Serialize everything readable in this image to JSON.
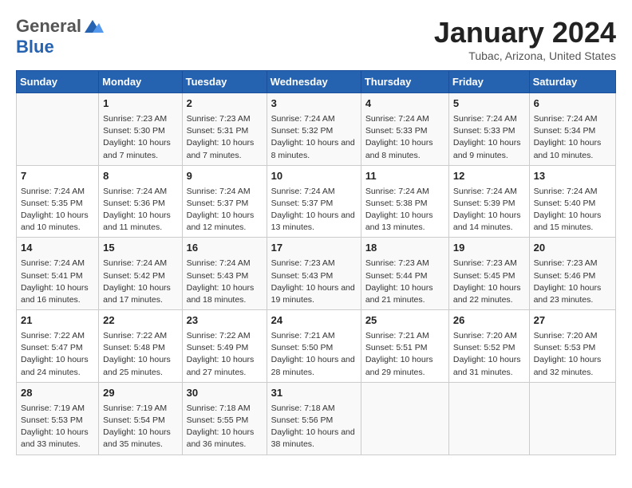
{
  "logo": {
    "general": "General",
    "blue": "Blue"
  },
  "calendar": {
    "title": "January 2024",
    "subtitle": "Tubac, Arizona, United States"
  },
  "headers": [
    "Sunday",
    "Monday",
    "Tuesday",
    "Wednesday",
    "Thursday",
    "Friday",
    "Saturday"
  ],
  "weeks": [
    [
      {
        "day": "",
        "sunrise": "",
        "sunset": "",
        "daylight": ""
      },
      {
        "day": "1",
        "sunrise": "Sunrise: 7:23 AM",
        "sunset": "Sunset: 5:30 PM",
        "daylight": "Daylight: 10 hours and 7 minutes."
      },
      {
        "day": "2",
        "sunrise": "Sunrise: 7:23 AM",
        "sunset": "Sunset: 5:31 PM",
        "daylight": "Daylight: 10 hours and 7 minutes."
      },
      {
        "day": "3",
        "sunrise": "Sunrise: 7:24 AM",
        "sunset": "Sunset: 5:32 PM",
        "daylight": "Daylight: 10 hours and 8 minutes."
      },
      {
        "day": "4",
        "sunrise": "Sunrise: 7:24 AM",
        "sunset": "Sunset: 5:33 PM",
        "daylight": "Daylight: 10 hours and 8 minutes."
      },
      {
        "day": "5",
        "sunrise": "Sunrise: 7:24 AM",
        "sunset": "Sunset: 5:33 PM",
        "daylight": "Daylight: 10 hours and 9 minutes."
      },
      {
        "day": "6",
        "sunrise": "Sunrise: 7:24 AM",
        "sunset": "Sunset: 5:34 PM",
        "daylight": "Daylight: 10 hours and 10 minutes."
      }
    ],
    [
      {
        "day": "7",
        "sunrise": "Sunrise: 7:24 AM",
        "sunset": "Sunset: 5:35 PM",
        "daylight": "Daylight: 10 hours and 10 minutes."
      },
      {
        "day": "8",
        "sunrise": "Sunrise: 7:24 AM",
        "sunset": "Sunset: 5:36 PM",
        "daylight": "Daylight: 10 hours and 11 minutes."
      },
      {
        "day": "9",
        "sunrise": "Sunrise: 7:24 AM",
        "sunset": "Sunset: 5:37 PM",
        "daylight": "Daylight: 10 hours and 12 minutes."
      },
      {
        "day": "10",
        "sunrise": "Sunrise: 7:24 AM",
        "sunset": "Sunset: 5:37 PM",
        "daylight": "Daylight: 10 hours and 13 minutes."
      },
      {
        "day": "11",
        "sunrise": "Sunrise: 7:24 AM",
        "sunset": "Sunset: 5:38 PM",
        "daylight": "Daylight: 10 hours and 13 minutes."
      },
      {
        "day": "12",
        "sunrise": "Sunrise: 7:24 AM",
        "sunset": "Sunset: 5:39 PM",
        "daylight": "Daylight: 10 hours and 14 minutes."
      },
      {
        "day": "13",
        "sunrise": "Sunrise: 7:24 AM",
        "sunset": "Sunset: 5:40 PM",
        "daylight": "Daylight: 10 hours and 15 minutes."
      }
    ],
    [
      {
        "day": "14",
        "sunrise": "Sunrise: 7:24 AM",
        "sunset": "Sunset: 5:41 PM",
        "daylight": "Daylight: 10 hours and 16 minutes."
      },
      {
        "day": "15",
        "sunrise": "Sunrise: 7:24 AM",
        "sunset": "Sunset: 5:42 PM",
        "daylight": "Daylight: 10 hours and 17 minutes."
      },
      {
        "day": "16",
        "sunrise": "Sunrise: 7:24 AM",
        "sunset": "Sunset: 5:43 PM",
        "daylight": "Daylight: 10 hours and 18 minutes."
      },
      {
        "day": "17",
        "sunrise": "Sunrise: 7:23 AM",
        "sunset": "Sunset: 5:43 PM",
        "daylight": "Daylight: 10 hours and 19 minutes."
      },
      {
        "day": "18",
        "sunrise": "Sunrise: 7:23 AM",
        "sunset": "Sunset: 5:44 PM",
        "daylight": "Daylight: 10 hours and 21 minutes."
      },
      {
        "day": "19",
        "sunrise": "Sunrise: 7:23 AM",
        "sunset": "Sunset: 5:45 PM",
        "daylight": "Daylight: 10 hours and 22 minutes."
      },
      {
        "day": "20",
        "sunrise": "Sunrise: 7:23 AM",
        "sunset": "Sunset: 5:46 PM",
        "daylight": "Daylight: 10 hours and 23 minutes."
      }
    ],
    [
      {
        "day": "21",
        "sunrise": "Sunrise: 7:22 AM",
        "sunset": "Sunset: 5:47 PM",
        "daylight": "Daylight: 10 hours and 24 minutes."
      },
      {
        "day": "22",
        "sunrise": "Sunrise: 7:22 AM",
        "sunset": "Sunset: 5:48 PM",
        "daylight": "Daylight: 10 hours and 25 minutes."
      },
      {
        "day": "23",
        "sunrise": "Sunrise: 7:22 AM",
        "sunset": "Sunset: 5:49 PM",
        "daylight": "Daylight: 10 hours and 27 minutes."
      },
      {
        "day": "24",
        "sunrise": "Sunrise: 7:21 AM",
        "sunset": "Sunset: 5:50 PM",
        "daylight": "Daylight: 10 hours and 28 minutes."
      },
      {
        "day": "25",
        "sunrise": "Sunrise: 7:21 AM",
        "sunset": "Sunset: 5:51 PM",
        "daylight": "Daylight: 10 hours and 29 minutes."
      },
      {
        "day": "26",
        "sunrise": "Sunrise: 7:20 AM",
        "sunset": "Sunset: 5:52 PM",
        "daylight": "Daylight: 10 hours and 31 minutes."
      },
      {
        "day": "27",
        "sunrise": "Sunrise: 7:20 AM",
        "sunset": "Sunset: 5:53 PM",
        "daylight": "Daylight: 10 hours and 32 minutes."
      }
    ],
    [
      {
        "day": "28",
        "sunrise": "Sunrise: 7:19 AM",
        "sunset": "Sunset: 5:53 PM",
        "daylight": "Daylight: 10 hours and 33 minutes."
      },
      {
        "day": "29",
        "sunrise": "Sunrise: 7:19 AM",
        "sunset": "Sunset: 5:54 PM",
        "daylight": "Daylight: 10 hours and 35 minutes."
      },
      {
        "day": "30",
        "sunrise": "Sunrise: 7:18 AM",
        "sunset": "Sunset: 5:55 PM",
        "daylight": "Daylight: 10 hours and 36 minutes."
      },
      {
        "day": "31",
        "sunrise": "Sunrise: 7:18 AM",
        "sunset": "Sunset: 5:56 PM",
        "daylight": "Daylight: 10 hours and 38 minutes."
      },
      {
        "day": "",
        "sunrise": "",
        "sunset": "",
        "daylight": ""
      },
      {
        "day": "",
        "sunrise": "",
        "sunset": "",
        "daylight": ""
      },
      {
        "day": "",
        "sunrise": "",
        "sunset": "",
        "daylight": ""
      }
    ]
  ]
}
